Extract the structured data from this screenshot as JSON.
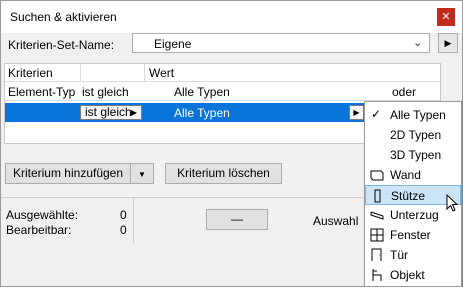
{
  "window": {
    "title": "Suchen & aktivieren",
    "close_icon": "close-icon"
  },
  "criteria_set": {
    "label": "Kriterien-Set-Name:",
    "value": "Eigene"
  },
  "table": {
    "col_criteria": "Kriterien",
    "col_value": "Wert",
    "sub_element_type": "Element-Typ",
    "sub_equals": "ist gleich",
    "sub_all_types": "Alle Typen",
    "sub_or": "oder",
    "row": {
      "operator": "ist gleich",
      "value": "Alle Typen"
    }
  },
  "buttons": {
    "add_criterion": "Kriterium hinzufügen",
    "delete_criterion": "Kriterium löschen",
    "dash": "—"
  },
  "status": {
    "selected_label": "Ausgewählte:",
    "selected_count": "0",
    "editable_label": "Bearbeitbar:",
    "editable_count": "0",
    "selection_label": "Auswahl"
  },
  "menu": {
    "items": [
      {
        "label": "Alle Typen",
        "icon": "checkmark-icon",
        "checked": true
      },
      {
        "label": "2D Typen",
        "icon": "",
        "checked": false
      },
      {
        "label": "3D Typen",
        "icon": "",
        "checked": false
      },
      {
        "label": "Wand",
        "icon": "wall-icon",
        "checked": false
      },
      {
        "label": "Stütze",
        "icon": "column-icon",
        "checked": false,
        "highlighted": true
      },
      {
        "label": "Unterzug",
        "icon": "beam-icon",
        "checked": false
      },
      {
        "label": "Fenster",
        "icon": "window-icon",
        "checked": false
      },
      {
        "label": "Tür",
        "icon": "door-icon",
        "checked": false
      },
      {
        "label": "Objekt",
        "icon": "object-icon",
        "checked": false
      }
    ]
  },
  "colors": {
    "selection": "#0a74d8",
    "highlight": "#cce4f7",
    "close": "#c42b1c"
  }
}
